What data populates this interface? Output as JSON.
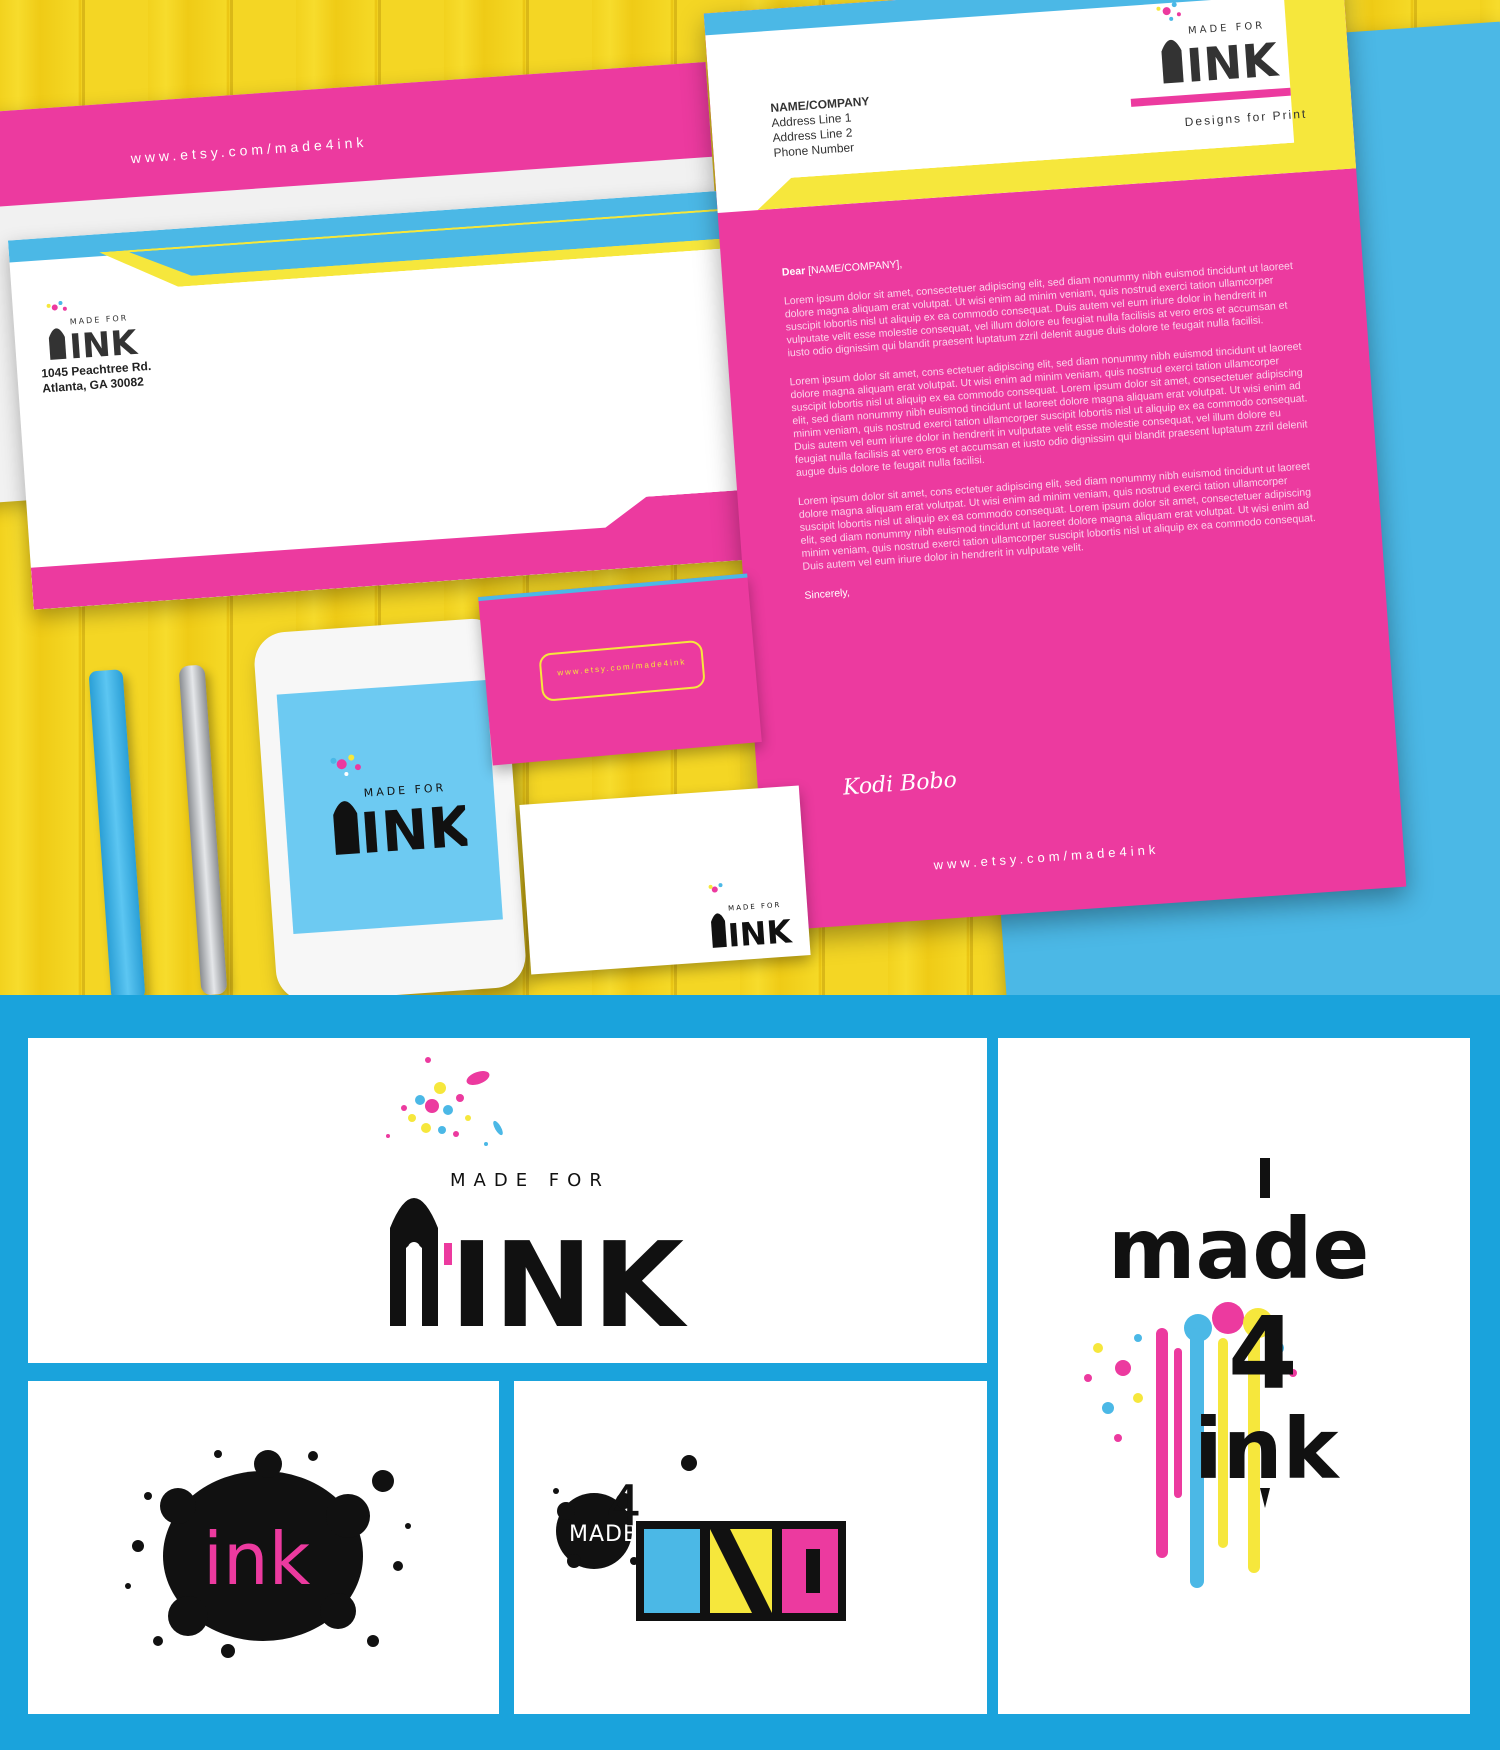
{
  "envelope": {
    "url": "www.etsy.com/made4ink",
    "address_line1": "1045 Peachtree Rd.",
    "address_line2": "Atlanta, GA 30082"
  },
  "letterhead": {
    "name_company": "NAME/COMPANY",
    "address_line1": "Address Line 1",
    "address_line2": "Address Line 2",
    "phone": "Phone Number",
    "tagline": "Designs for Print",
    "greeting_bold": "Dear",
    "greeting_rest": " [NAME/COMPANY],",
    "paragraphs": [
      "Lorem ipsum dolor sit amet, consectetuer adipiscing elit, sed diam nonummy nibh euismod tincidunt ut laoreet dolore magna aliquam erat volutpat. Ut wisi enim ad minim veniam, quis nostrud exerci tation ullamcorper suscipit lobortis nisl ut aliquip ex ea commodo consequat. Duis autem vel eum iriure dolor in hendrerit in vulputate velit esse molestie consequat, vel illum dolore eu feugiat nulla facilisis at vero eros et accumsan et iusto odio dignissim qui blandit praesent luptatum zzril delenit augue duis dolore te feugait nulla facilisi.",
      "Lorem ipsum dolor sit amet, cons ectetuer adipiscing elit, sed diam nonummy nibh euismod tincidunt ut laoreet dolore magna aliquam erat volutpat. Ut wisi enim ad minim veniam, quis nostrud exerci tation ullamcorper suscipit lobortis nisl ut aliquip ex ea commodo consequat. Lorem ipsum dolor sit amet, consectetuer adipiscing elit, sed diam nonummy nibh euismod tincidunt ut laoreet dolore magna aliquam erat volutpat. Ut wisi enim ad minim veniam, quis nostrud exerci tation ullamcorper suscipit lobortis nisl ut aliquip ex ea commodo consequat. Duis autem vel eum iriure dolor in hendrerit in vulputate velit esse molestie consequat, vel illum dolore eu feugiat nulla facilisis at vero eros et accumsan et iusto odio dignissim qui blandit praesent luptatum zzril delenit augue duis dolore te feugait nulla facilisi.",
      "Lorem ipsum dolor sit amet, cons ectetuer adipiscing elit, sed diam nonummy nibh euismod tincidunt ut laoreet dolore magna aliquam erat volutpat. Ut wisi enim ad minim veniam, quis nostrud exerci tation ullamcorper suscipit lobortis nisl ut aliquip ex ea commodo consequat. Lorem ipsum dolor sit amet, consectetuer adipiscing elit, sed diam nonummy nibh euismod tincidunt ut laoreet dolore magna aliquam erat volutpat. Ut wisi enim ad minim veniam, quis nostrud exerci tation ullamcorper suscipit lobortis nisl ut aliquip ex ea commodo consequat. Duis autem vel eum iriure dolor in hendrerit in vulputate velit."
    ],
    "closing": "Sincerely,",
    "signature": "Kodi Bobo",
    "url": "www.etsy.com/made4ink"
  },
  "business_card": {
    "url": "www.etsy.com/made4ink"
  },
  "logos": {
    "made_for": "MADE FOR",
    "ink_word": "INK",
    "vertical": {
      "made": "made",
      "four": "4",
      "ink": "ink"
    },
    "splat_ink": "ink",
    "badge_made": "MADE",
    "badge_four": "4"
  },
  "colors": {
    "magenta": "#ec3a9f",
    "cyan": "#4bb8e6",
    "yellow": "#f6e73c",
    "wood": "#f2d21e",
    "frame": "#1aa3dc"
  }
}
